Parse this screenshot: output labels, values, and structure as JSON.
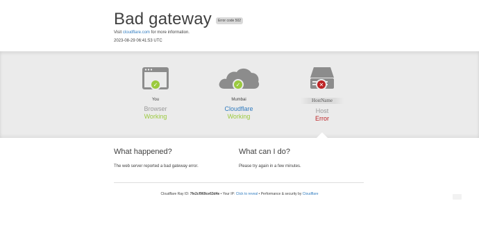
{
  "header": {
    "title": "Bad gateway",
    "error_code": "Error code 502",
    "visit_prefix": "Visit",
    "visit_link": "cloudflare.com",
    "visit_suffix": "for more information.",
    "timestamp": "2023-08-29 06:41:53 UTC"
  },
  "status_chain": [
    {
      "location": "You",
      "kind": "Browser",
      "state": "Working",
      "icon": "browser-window-icon",
      "result": "ok"
    },
    {
      "location": "Mumbai",
      "kind": "Cloudflare",
      "state": "Working",
      "icon": "cloud-icon",
      "result": "ok"
    },
    {
      "location": "HostName",
      "kind": "Host",
      "state": "Error",
      "icon": "server-icon",
      "result": "error"
    }
  ],
  "what_happened": {
    "heading": "What happened?",
    "text": "The web server reported a bad gateway error."
  },
  "what_can_i_do": {
    "heading": "What can I do?",
    "text": "Please try again in a few minutes."
  },
  "footer": {
    "ray_label": "Cloudflare Ray ID:",
    "ray_id": "7fe2cf969ce63d4e",
    "sep1": "•",
    "ip_label": "Your IP:",
    "ip_link": "Click to reveal",
    "sep2": "•",
    "perf_label": "Performance & security by",
    "perf_link": "Cloudflare"
  },
  "colors": {
    "ok": "#9bca3e",
    "error": "#bd2426",
    "link": "#2f7bbf",
    "band": "#ebebeb",
    "icon_gray": "#8c8c8c"
  }
}
